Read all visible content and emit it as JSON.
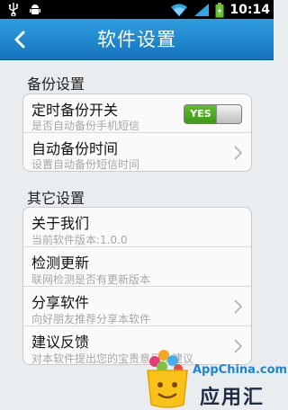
{
  "status_bar": {
    "time": "10:14"
  },
  "header": {
    "title": "软件设置"
  },
  "sections": [
    {
      "title": "备份设置",
      "rows": [
        {
          "label": "定时备份开关",
          "sub": "是否自动备份手机短信",
          "toggle": "YES"
        },
        {
          "label": "自动备份时间",
          "sub": "设置自动备份短信时间"
        }
      ]
    },
    {
      "title": "其它设置",
      "rows": [
        {
          "label": "关于我们",
          "sub": "当前软件版本:1.0.0"
        },
        {
          "label": "检测更新",
          "sub": "联网检测是否有更新版本"
        },
        {
          "label": "分享软件",
          "sub": "向好朋友推荐分享本软件"
        },
        {
          "label": "建议反馈",
          "sub": "对本软件提出您的宝贵意见及建议"
        }
      ]
    }
  ],
  "watermark": {
    "site": "AppChina.com",
    "brand": "应用汇"
  },
  "colors": {
    "header": "#1e86d0",
    "toggle_on": "#4cab22",
    "background": "#e9edf0"
  }
}
